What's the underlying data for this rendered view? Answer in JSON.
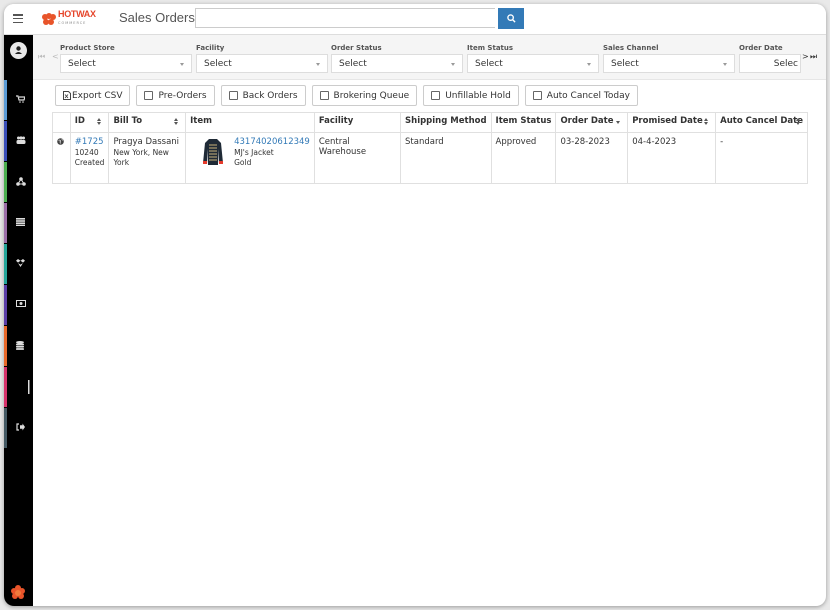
{
  "header": {
    "logo_text": "HOTWAX",
    "logo_subtext": "COMMERCE",
    "page_title": "Sales Orders",
    "search": {
      "value": "",
      "placeholder": ""
    },
    "search_icon": "search-icon"
  },
  "sidebar": {
    "items": [
      {
        "name": "orders",
        "icon": "cart-icon",
        "color": "#5b9bd5"
      },
      {
        "name": "customers",
        "icon": "users-icon",
        "color": "#3b4fb8"
      },
      {
        "name": "facilities",
        "icon": "network-icon",
        "color": "#4caf50"
      },
      {
        "name": "catalog",
        "icon": "list-icon",
        "color": "#9c6fa8"
      },
      {
        "name": "returns",
        "icon": "dropbox-icon",
        "color": "#26a69a"
      },
      {
        "name": "payments",
        "icon": "money-icon",
        "color": "#5c3fa8"
      },
      {
        "name": "database",
        "icon": "database-icon",
        "color": "#e8692a"
      },
      {
        "name": "reports",
        "icon": "bar-icon",
        "color": "#d6336c"
      },
      {
        "name": "logout",
        "icon": "signout-icon",
        "color": "#455a64"
      }
    ]
  },
  "filters": [
    {
      "label": "Product Store",
      "value": "Select"
    },
    {
      "label": "Facility",
      "value": "Select"
    },
    {
      "label": "Order Status",
      "value": "Select"
    },
    {
      "label": "Item Status",
      "value": "Select"
    },
    {
      "label": "Sales Channel",
      "value": "Select"
    },
    {
      "label": "Order Date",
      "value": "Selec"
    }
  ],
  "pager": {
    "first": "⏮",
    "prev": "<",
    "next": ">",
    "last": "⏭"
  },
  "toolbar": {
    "export_label": "Export CSV",
    "checkboxes": [
      {
        "label": "Pre-Orders",
        "checked": false
      },
      {
        "label": "Back Orders",
        "checked": false
      },
      {
        "label": "Brokering Queue",
        "checked": false
      },
      {
        "label": "Unfillable Hold",
        "checked": false
      },
      {
        "label": "Auto Cancel Today",
        "checked": false
      }
    ]
  },
  "table": {
    "columns": [
      "",
      "ID",
      "Bill To",
      "Item",
      "Facility",
      "Shipping Method",
      "Item Status",
      "Order Date",
      "Promised Date",
      "Auto Cancel Date"
    ],
    "rows": [
      {
        "id": "#1725",
        "id_sub1": "10240",
        "id_sub2": "Created",
        "bill_to_name": "Pragya Dassani",
        "bill_to_location": "New York, New York",
        "item_sku": "43174020612349",
        "item_name": "MJ's Jacket",
        "item_variant": "Gold",
        "facility": "Central Warehouse",
        "shipping_method": "Standard",
        "item_status": "Approved",
        "order_date": "03-28-2023",
        "promised_date": "04-4-2023",
        "auto_cancel_date": "-"
      }
    ]
  }
}
